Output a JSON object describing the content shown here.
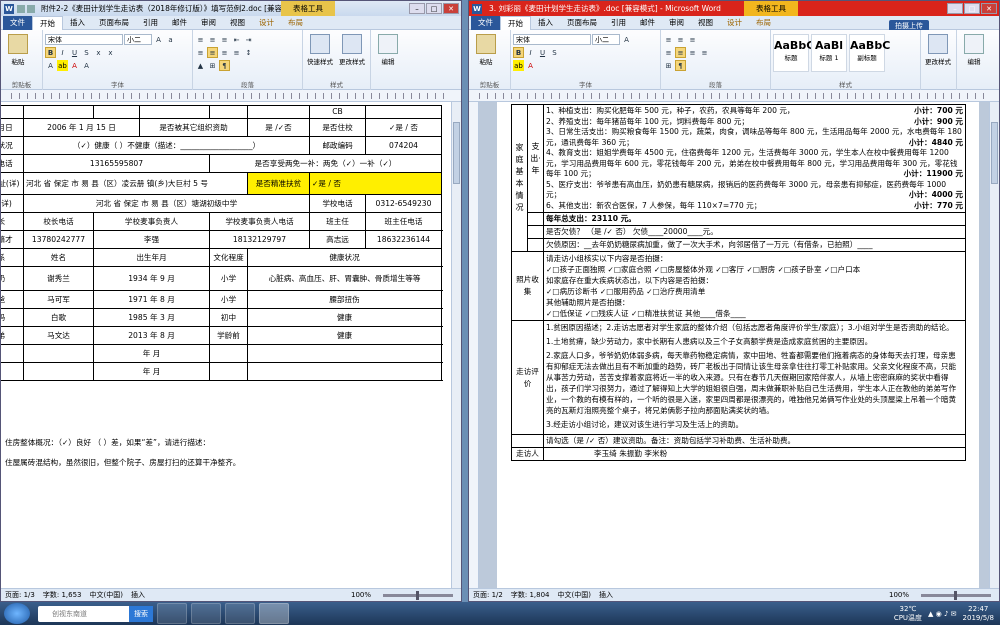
{
  "left_window": {
    "title": "附件2-2《麦田计划学生走访表（2018年修订版）》填写范例2.doc [兼容...",
    "context_tab": "表格工具",
    "tabs": [
      "文件",
      "开始",
      "插入",
      "页面布局",
      "引用",
      "邮件",
      "审阅",
      "视图",
      "设计",
      "布局"
    ],
    "ribbon": {
      "paste": "粘贴",
      "clipboard": "剪贴板",
      "font_name": "宋体",
      "font_size": "小二",
      "font_group": "字体",
      "para_group": "段落",
      "quick_style": "快速样式",
      "change_style": "更改样式",
      "styles_group": "样式",
      "edit": "编辑"
    },
    "table": {
      "rows": [
        [
          "",
          "",
          "",
          "",
          "",
          "",
          "CB",
          ""
        ],
        [
          "生年月日",
          "2006 年 1 月 15 日",
          "",
          "是否被其它组织资助",
          "是 /✓否",
          "",
          "是否住校",
          "✓是 / 否"
        ],
        [
          "身体状况",
          "（✓）健康（ ）不健康（描述：___________________）",
          "",
          "",
          "",
          "",
          "邮政编码",
          "074204"
        ],
        [
          "联系电话",
          "",
          "13165595807",
          "",
          "是否享受两免一补：两免（✓）一补（✓）",
          "",
          "",
          ""
        ],
        [
          "家庭地址(详)",
          "河北 省 保定 市 易 县（区）凌云册 镇(乡)大巨村 5 号",
          "",
          "",
          "",
          "是否精准扶贫",
          "✓是 / 否",
          ""
        ],
        [
          "学校(详)",
          "河北 省 保定 市 易 县（区）塘湖初级中学",
          "",
          "",
          "",
          "学校电话",
          "0312-6549230",
          ""
        ],
        [
          "校长",
          "校长电话",
          "学校麦事负责人",
          "学校麦事负责人电话",
          "",
          "班主任",
          "班主任电话",
          ""
        ],
        [
          "电话籍才",
          "13780242777",
          "李强",
          "18132129797",
          "",
          "高志远",
          "18632236144",
          ""
        ],
        [
          "关系",
          "姓名",
          "出生年月",
          "文化程度",
          "健康状况",
          "",
          "职业",
          ""
        ],
        [
          "奶奶",
          "谢秀兰",
          "1934 年 9 月",
          "小学",
          "心脏病、高血压、肝、胃囊肿、骨质增生等等",
          "",
          "无",
          ""
        ],
        [
          "爸爸",
          "马可军",
          "1971 年 8 月",
          "小学",
          "腰部扭伤",
          "",
          "务农",
          ""
        ],
        [
          "妈妈",
          "白歌",
          "1985 年 3 月",
          "初中",
          "健康",
          "",
          "务农",
          ""
        ],
        [
          "弟弟",
          "马文达",
          "2013 年 8 月",
          "学龄前",
          "健康",
          "",
          "无",
          ""
        ],
        [
          "",
          "",
          "年 月",
          "",
          "",
          "",
          "",
          ""
        ],
        [
          "",
          "",
          "年 月",
          "",
          "",
          "",
          "",
          ""
        ]
      ],
      "house_line": "住房整体概况：（✓）良好 （ ）差，如果“差”，请进行描述：",
      "house_desc": "住屋属砖混结构，虽然很旧，但整个院子、房屋打扫的还算干净整齐。"
    },
    "status": {
      "page": "页面: 1/3",
      "words": "字数: 1,653",
      "lang": "中文(中国)",
      "mode": "插入",
      "zoom": "100%"
    }
  },
  "right_window": {
    "title": "3. 刘彩丽《麦田计划学生走访表》.doc [兼容模式] - Microsoft Word",
    "context_tab": "表格工具",
    "share": "拍摄上传",
    "tabs": [
      "文件",
      "开始",
      "插入",
      "页面布局",
      "引用",
      "邮件",
      "审阅",
      "视图",
      "设计",
      "布局"
    ],
    "ribbon": {
      "paste": "粘贴",
      "clipboard": "剪贴板",
      "font_name": "宋体",
      "font_size": "小二",
      "font_group": "字体",
      "para_group": "段落",
      "styles_group": "样式",
      "change_style": "更改样式",
      "edit": "编辑",
      "style_names": [
        "标题",
        "标题 1",
        "副标题"
      ],
      "style_sample": [
        "AaBbC",
        "AaBl",
        "AaBbC"
      ]
    },
    "sections": {
      "family_label": "家庭基本情况",
      "expense_label": "支出·年",
      "expenses": [
        {
          "t": "1、种植支出：购买化肥每年 500 元，种子，农药，农具等每年 200 元，",
          "s": "小计：700 元"
        },
        {
          "t": "2、养殖支出：每年猪苗每年 100 元，饲料费每年 800 元；",
          "s": "小计：900 元"
        },
        {
          "t": "3、日常生活支出：购买粮食每年 1500 元，蔬菜，肉食，调味品等每年 800 元，生活用品每年 2000 元，水电费每年 180 元，通讯费每年 360 元；",
          "s": "小计：4840 元"
        },
        {
          "t": "4、教育支出：姐姐学费每年 4500 元，住宿费每年 1200 元，生活费每年 3000 元，学生本人在校中餐费用每年 1200 元，学习用品费用每年 600 元，零花钱每年 200 元，弟弟在校中餐费用每年 800 元，学习用品费用每年 300 元，零花钱每年 100 元；",
          "s": "小计：11900 元"
        },
        {
          "t": "5、医疗支出：爷爷患有高血压，奶奶患有糖尿病，报销后的医药费每年 3000 元，母亲患有抑郁症，医药费每年 1000 元；",
          "s": "小计：4000 元"
        },
        {
          "t": "6、其他支出：新农合医保，7 人参保，每年 110×7=770 元；",
          "s": "小计：770 元"
        }
      ],
      "total": "每年总支出：23110 元。",
      "debt": "是否欠债？ （是 /✓ 否） 欠债____20000____元。",
      "debt_reason": "欠债原因：__去年奶奶糖尿病加重，做了一次大手术，向邻居借了一万元（有借条，已拍照）____",
      "photo_label": "照片收集",
      "photo_lines": [
        "请走访小组核实以下内容是否拍摄：",
        "✓□孩子正面独照 ✓□家庭合照 ✓□房屋整体外观 ✓□客厅 ✓□厨房 ✓□孩子卧室 ✓□户口本",
        "如家庭存在重大疾病状态出，以下内容是否拍摄：",
        "✓□病历诊断书 ✓□服用药品 ✓□治疗费用清单",
        "其他辅助照片是否拍摄：",
        "✓□低保证 ✓□残疾人证 ✓□精准扶贫证 其他____借条____"
      ],
      "eval_label": "走访评价",
      "eval_lines": [
        "1.贫困原因描述；2.走访志愿者对学生家庭的整体介绍（包括志愿者角度评价学生/家庭）；3.小组对学生是否资助的结论。",
        "1.土地贫瘠，缺少劳动力，家中长期有人患病以及三个子女高额学费是造成家庭贫困的主要原因。",
        "2.家庭人口多，爷爷奶奶体弱多病，每天靠药物稳定病情，家中田地、牲畜都需要他们拖着病态的身体每天去打理，母亲患有抑郁症无法去做出且有不断加重的趋势，砖厂老板出于同情让该生母亲拿住往打零工补贴家用。父亲文化程度不高，只能从事苦力劳动，苦苦支撑着家庭将近一半的收入来源。只有在春节几天假期回家陪伴家人，从墙上密密麻麻的奖状中看得出，孩子们学习很努力，通过了解得知上大学的姐姐很自强，周末做兼职补贴自己生活费用，学生本人正在教他的弟弟写作业，一个教的有模有样的，一个听的很是入迷，家里四周都是很漂亮的，唯独他兄弟俩写作业处的头顶屋梁上吊着一个暗黄亮的瓦斯灯泡照亮整个桌子，将兄弟俩影子拉向那面贴满奖状的墙。",
        "3.经走访小组讨论，建议对该生进行学习及生活上的资助。"
      ],
      "advice": "请勾选（是 /✓ 否）建议资助。备注：资助包括学习补助费、生活补助费。",
      "visitor_label": "走访人",
      "visitors": "李玉绮 朱振勤 李米粉"
    },
    "status": {
      "page": "页面: 1/2",
      "words": "字数: 1,804",
      "lang": "中文(中国)",
      "mode": "插入",
      "zoom": "100%"
    }
  },
  "taskbar": {
    "search_placeholder": "创视东南道",
    "search_btn": "搜索",
    "temp": "32℃",
    "cpu": "CPU温度",
    "time": "22:47",
    "date": "2019/5/8"
  }
}
